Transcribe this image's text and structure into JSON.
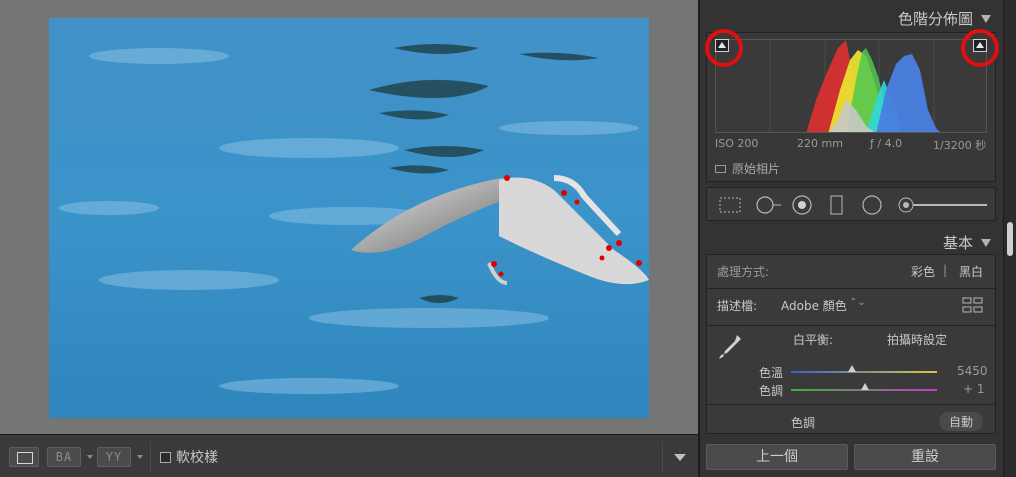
{
  "histogram_panel": {
    "title": "色階分佈圖",
    "iso": "ISO 200",
    "focal": "220 mm",
    "aperture": "ƒ / 4.0",
    "shutter": "1/3200 秒",
    "original_photo_label": "原始相片"
  },
  "basic_panel": {
    "title": "基本",
    "treatment_label": "處理方式:",
    "treatment_color": "彩色",
    "treatment_bw": "黑白",
    "profile_label": "描述檔:",
    "profile_value": "Adobe 顏色",
    "wb_label": "白平衡:",
    "wb_value": "拍攝時設定",
    "temp_label": "色溫",
    "temp_value": "5450",
    "temp_level": 0.42,
    "tint_label": "色調",
    "tint_value": "+ 1",
    "tint_level": 0.51,
    "tone_label": "色調",
    "auto_label": "自動"
  },
  "toolbar": {
    "ba_label": "BA",
    "yy_label": "YY",
    "softproof_label": "軟校樣"
  },
  "buttons": {
    "previous_label": "上一個",
    "reset_label": "重設"
  },
  "colors": {
    "clip_highlight": "#e01010",
    "panel_bg": "#333333",
    "water": "#3a90c6"
  },
  "icons": [
    "crop-overlay-icon",
    "spot-removal-icon",
    "red-eye-icon",
    "graduated-filter-icon",
    "radial-filter-icon",
    "adjustment-brush-icon",
    "eyedropper-icon"
  ]
}
